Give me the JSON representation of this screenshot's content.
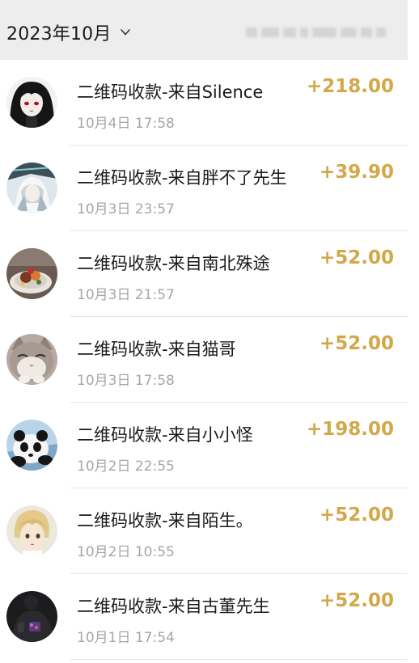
{
  "header": {
    "month_label": "2023年10月"
  },
  "transactions": [
    {
      "title": "二维码收款-来自Silence",
      "time": "10月4日 17:58",
      "amount": "+218.00",
      "avatar": "anime-girl-avatar"
    },
    {
      "title": "二维码收款-来自胖不了先生",
      "time": "10月3日 23:57",
      "amount": "+39.90",
      "avatar": "anime-character-avatar"
    },
    {
      "title": "二维码收款-来自南北殊途",
      "time": "10月3日 21:57",
      "amount": "+52.00",
      "avatar": "dessert-plate-avatar"
    },
    {
      "title": "二维码收款-来自猫哥",
      "time": "10月3日 17:58",
      "amount": "+52.00",
      "avatar": "cat-avatar"
    },
    {
      "title": "二维码收款-来自小小怪",
      "time": "10月2日 22:55",
      "amount": "+198.00",
      "avatar": "panda-avatar"
    },
    {
      "title": "二维码收款-来自陌生。",
      "time": "10月2日 10:55",
      "amount": "+52.00",
      "avatar": "anime-boy-avatar"
    },
    {
      "title": "二维码收款-来自古董先生",
      "time": "10月1日 17:54",
      "amount": "+52.00",
      "avatar": "dark-photo-avatar"
    }
  ],
  "colors": {
    "amount": "#d2a84a",
    "header_bg": "#ededed",
    "secondary_text": "#a6a6a6"
  }
}
